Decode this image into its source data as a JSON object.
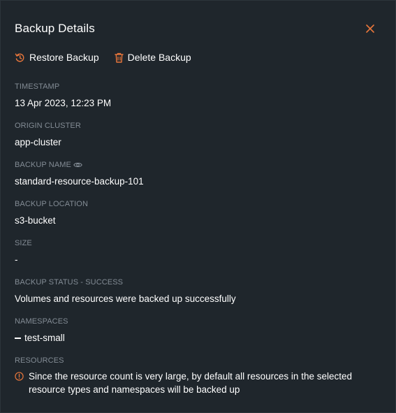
{
  "panel": {
    "title": "Backup Details",
    "accent_color": "#e8763b"
  },
  "actions": {
    "restore_label": "Restore Backup",
    "delete_label": "Delete Backup"
  },
  "fields": {
    "timestamp": {
      "label": "TIMESTAMP",
      "value": "13 Apr 2023, 12:23 PM"
    },
    "origin_cluster": {
      "label": "ORIGIN CLUSTER",
      "value": "app-cluster"
    },
    "backup_name": {
      "label": "BACKUP NAME",
      "value": "standard-resource-backup-101"
    },
    "backup_location": {
      "label": "BACKUP LOCATION",
      "value": "s3-bucket"
    },
    "size": {
      "label": "SIZE",
      "value": "-"
    },
    "backup_status": {
      "label": "BACKUP STATUS - SUCCESS",
      "value": "Volumes and resources were backed up successfully"
    },
    "namespaces": {
      "label": "NAMESPACES",
      "items": [
        "test-small"
      ]
    },
    "resources": {
      "label": "RESOURCES",
      "value": "Since the resource count is very large, by default all resources in the selected resource types and namespaces will be backed up"
    }
  },
  "icons": {
    "close": "close-icon",
    "restore": "restore-icon",
    "delete": "trash-icon",
    "reveal": "eye-icon",
    "info": "info-icon"
  }
}
